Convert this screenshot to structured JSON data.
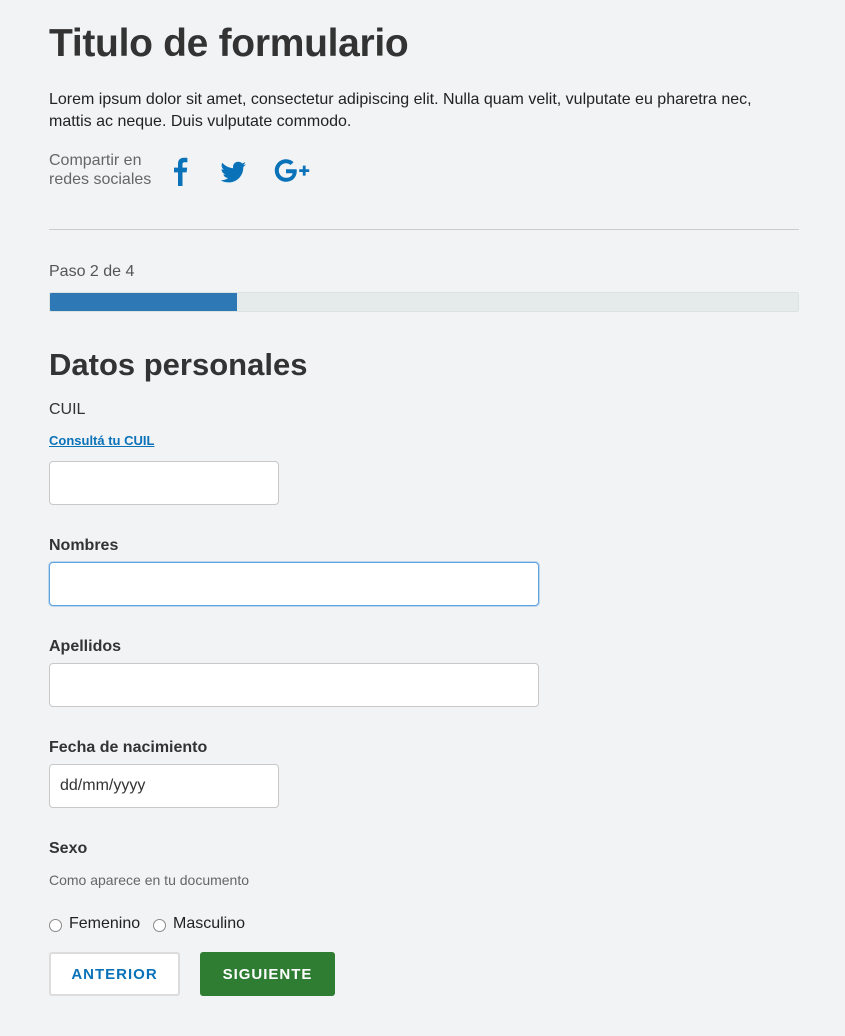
{
  "header": {
    "title": "Titulo de formulario",
    "description": "Lorem ipsum dolor sit amet, consectetur adipiscing elit. Nulla quam velit, vulputate eu pharetra nec, mattis ac neque. Duis vulputate commodo."
  },
  "share": {
    "label_line1": "Compartir en",
    "label_line2": "redes sociales",
    "icons": [
      "facebook-icon",
      "twitter-icon",
      "google-plus-icon"
    ],
    "icon_color": "#0a72b8"
  },
  "progress": {
    "step_text": "Paso 2 de 4",
    "current_step": 2,
    "total_steps": 4,
    "fill_fraction": 0.25,
    "fill_color": "#2e78b6"
  },
  "form": {
    "section_title": "Datos personales",
    "cuil": {
      "label": "CUIL",
      "help_link": "Consultá tu CUIL",
      "value": ""
    },
    "nombres": {
      "label": "Nombres",
      "value": ""
    },
    "apellidos": {
      "label": "Apellidos",
      "value": ""
    },
    "fecha_nacimiento": {
      "label": "Fecha de nacimiento",
      "placeholder": "dd/mm/yyyy"
    },
    "sexo": {
      "label": "Sexo",
      "hint": "Como aparece en tu documento",
      "options": [
        "Femenino",
        "Masculino"
      ]
    }
  },
  "actions": {
    "previous_label": "ANTERIOR",
    "next_label": "SIGUIENTE",
    "next_color": "#2e7d32",
    "link_color": "#0a72b8"
  }
}
